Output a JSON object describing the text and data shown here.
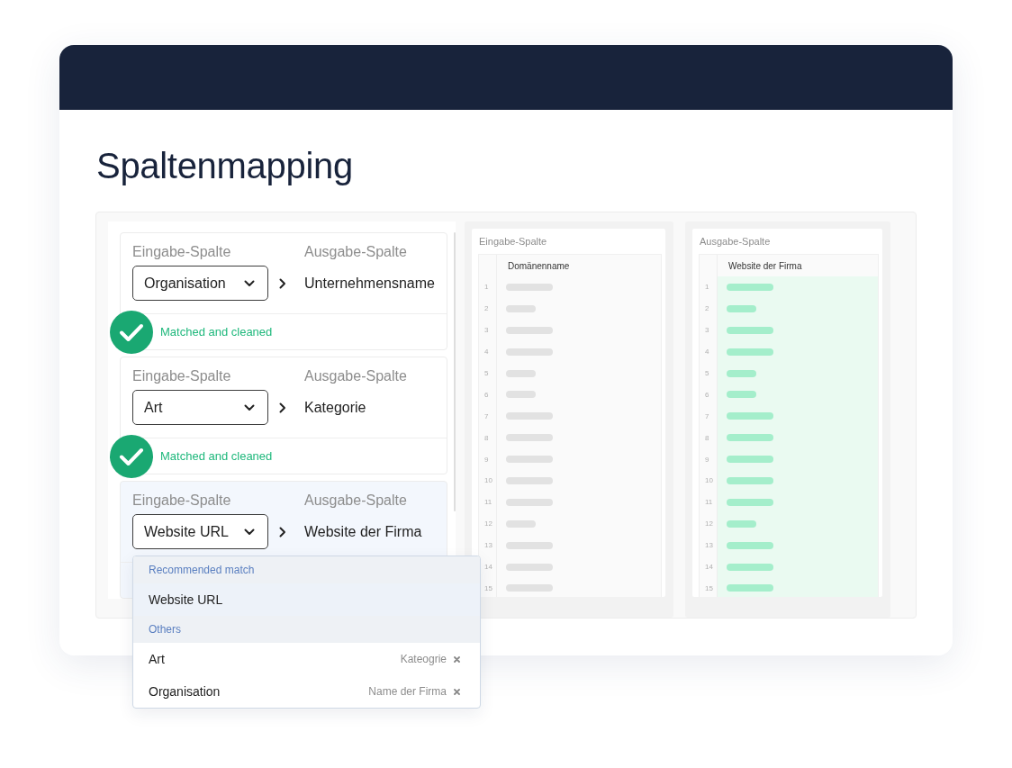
{
  "page": {
    "title": "Spaltenmapping"
  },
  "mappings": [
    {
      "input_label": "Eingabe-Spalte",
      "input_value": "Organisation",
      "output_label": "Ausgabe-Spalte",
      "output_value": "Unternehmensname",
      "status": "Matched and cleaned",
      "selected": false
    },
    {
      "input_label": "Eingabe-Spalte",
      "input_value": "Art",
      "output_label": "Ausgabe-Spalte",
      "output_value": "Kategorie",
      "status": "Matched and cleaned",
      "selected": false
    },
    {
      "input_label": "Eingabe-Spalte",
      "input_value": "Website URL",
      "output_label": "Ausgabe-Spalte",
      "output_value": "Website der Firma",
      "selected": true
    }
  ],
  "dropdown": {
    "sections": [
      {
        "heading": "Recommended match",
        "options": [
          {
            "label": "Website URL",
            "selected": true
          }
        ]
      },
      {
        "heading": "Others",
        "options": [
          {
            "label": "Art",
            "tag": "Kateogrie",
            "selected": false
          },
          {
            "label": "Organisation",
            "tag": "Name der Firma",
            "selected": false
          }
        ]
      }
    ]
  },
  "previews": [
    {
      "kind": "input",
      "title": "Eingabe-Spalte",
      "column": "Domänenname",
      "rows": [
        {
          "number": "1"
        },
        {
          "number": "2"
        },
        {
          "number": "3"
        },
        {
          "number": "4"
        },
        {
          "number": "5"
        },
        {
          "number": "6"
        },
        {
          "number": "7"
        },
        {
          "number": "8"
        },
        {
          "number": "9"
        },
        {
          "number": "10"
        },
        {
          "number": "11"
        },
        {
          "number": "12"
        },
        {
          "number": "13"
        },
        {
          "number": "14"
        },
        {
          "number": "15"
        }
      ]
    },
    {
      "kind": "output",
      "title": "Ausgabe-Spalte",
      "column": "Website der Firma",
      "rows": [
        {
          "number": "1"
        },
        {
          "number": "2"
        },
        {
          "number": "3"
        },
        {
          "number": "4"
        },
        {
          "number": "5"
        },
        {
          "number": "6"
        },
        {
          "number": "7"
        },
        {
          "number": "8"
        },
        {
          "number": "9"
        },
        {
          "number": "10"
        },
        {
          "number": "11"
        },
        {
          "number": "12"
        },
        {
          "number": "13"
        },
        {
          "number": "14"
        },
        {
          "number": "15"
        }
      ]
    }
  ]
}
